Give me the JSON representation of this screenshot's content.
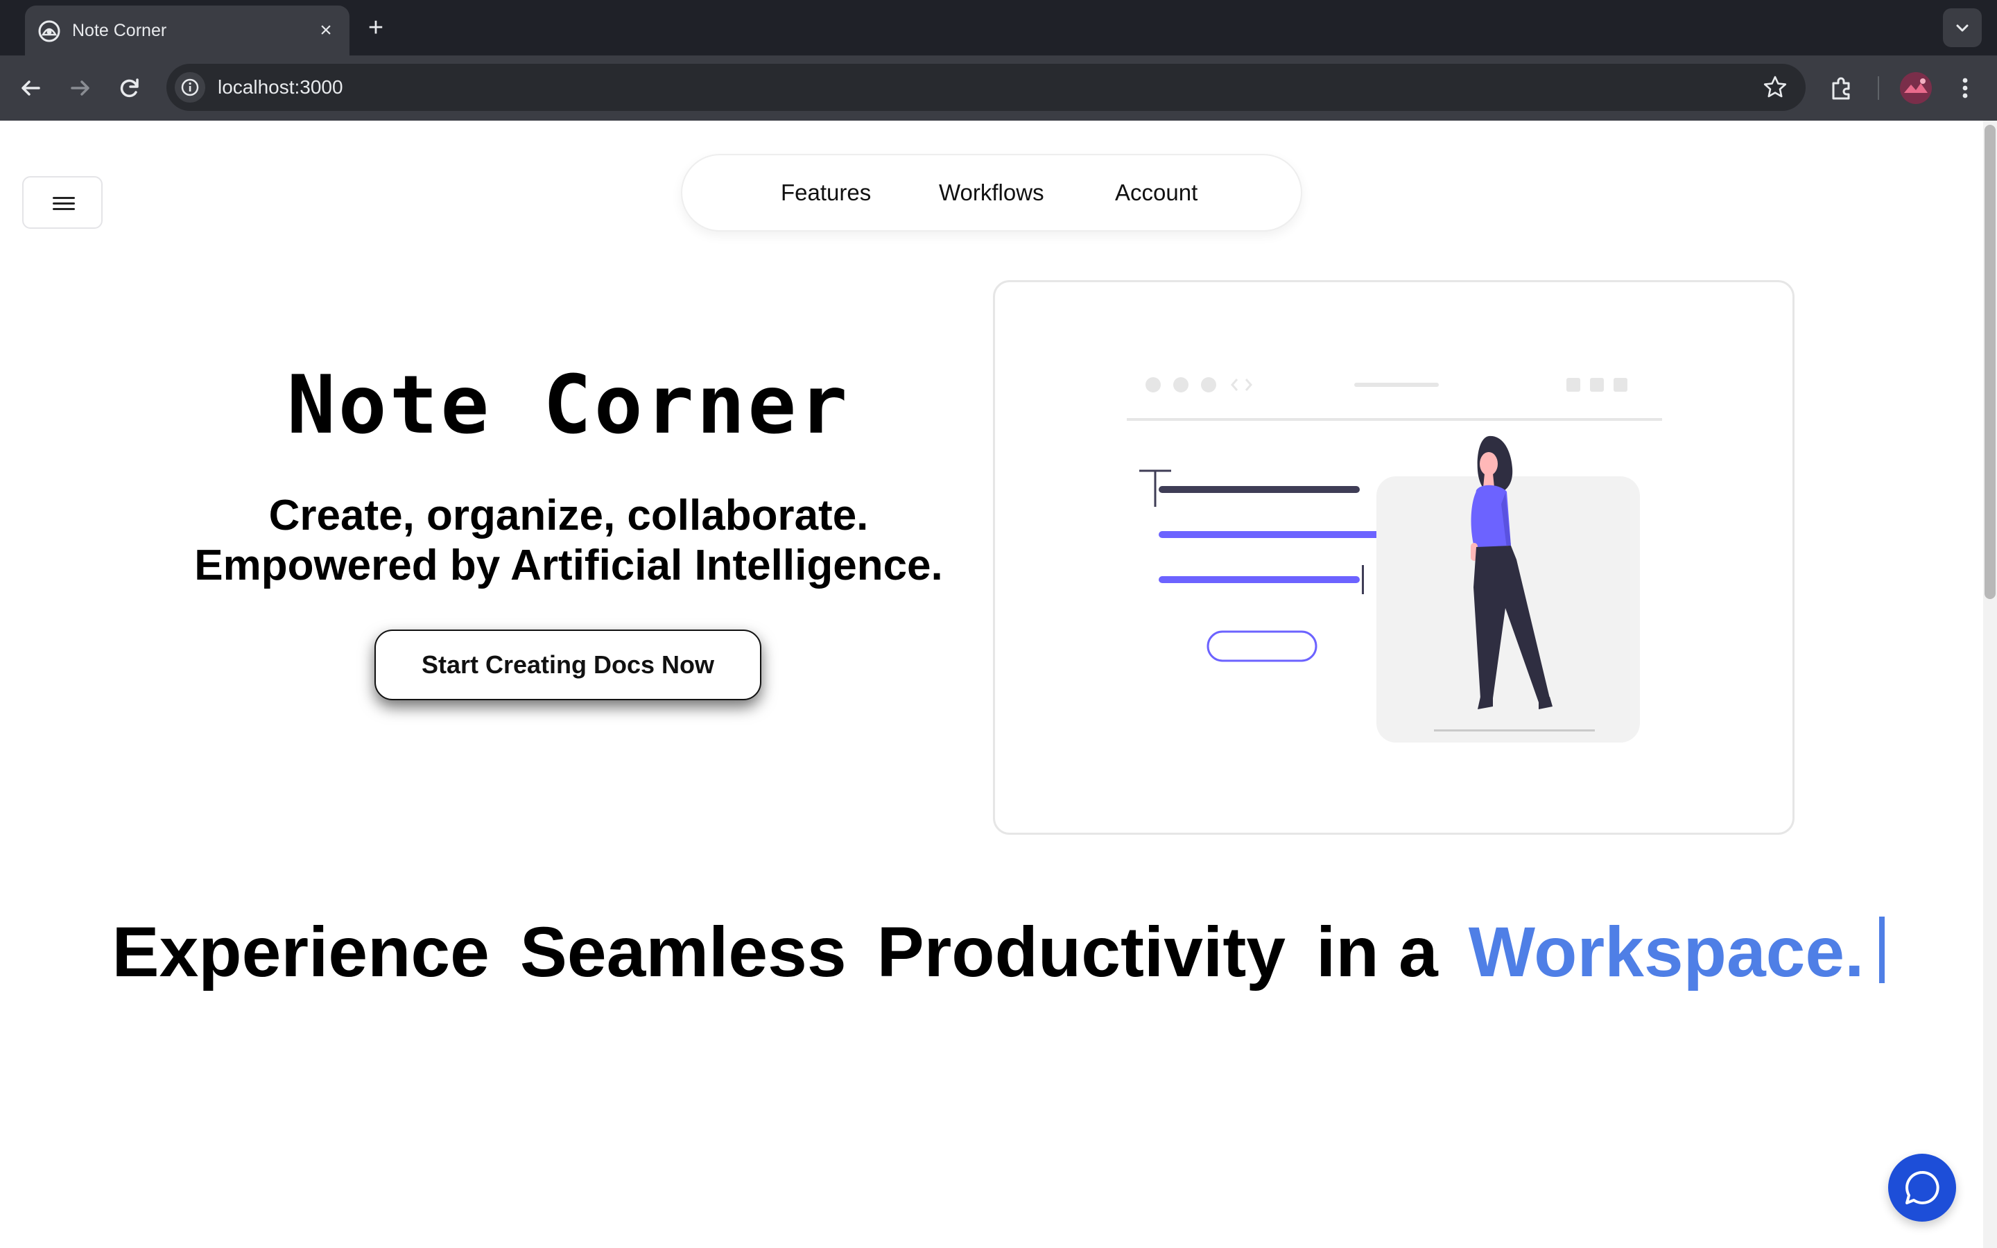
{
  "browser": {
    "tab_title": "Note Corner",
    "tab_close_icon": "close-icon",
    "new_tab_icon": "plus-icon",
    "url": "localhost:3000"
  },
  "page": {
    "nav": {
      "items": [
        {
          "label": "Features"
        },
        {
          "label": "Workflows"
        },
        {
          "label": "Account"
        }
      ]
    },
    "hero": {
      "title": "Note Corner",
      "subtitle_line1": "Create, organize, collaborate.",
      "subtitle_line2": "Empowered by Artificial Intelligence.",
      "cta_label": "Start Creating Docs Now"
    },
    "tagline": {
      "word1": "Experience",
      "word2": "Seamless",
      "word3": "Productivity",
      "word4": "in a",
      "highlight": "Workspace."
    }
  },
  "colors": {
    "accent_blue": "#4f7fe6",
    "illustration_purple": "#6c63ff",
    "chat_button": "#1d4ed8"
  }
}
